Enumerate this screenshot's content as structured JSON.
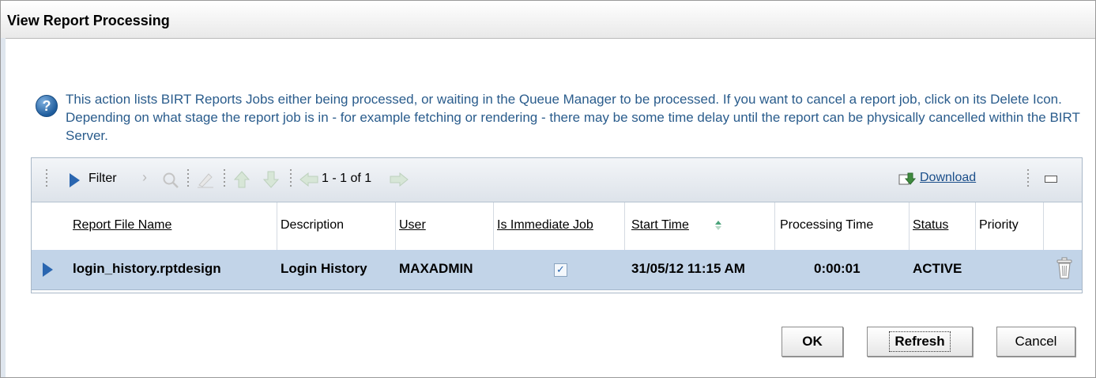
{
  "dialog": {
    "title": "View Report Processing"
  },
  "info": {
    "text": "This action lists BIRT Reports Jobs either being processed, or waiting in the Queue Manager to be processed. If you want to cancel a report job, click on its Delete Icon. Depending on what stage the report job is in - for example fetching or rendering - there may be some time delay until the report can be physically cancelled within the BIRT Server."
  },
  "toolbar": {
    "filter_label": "Filter",
    "pagination": "1 - 1 of 1",
    "download_label": "Download"
  },
  "table": {
    "headers": [
      "Report File Name",
      "Description",
      "User",
      "Is Immediate Job",
      "Start Time",
      "Processing Time",
      "Status",
      "Priority"
    ],
    "rows": [
      {
        "file_name": "login_history.rptdesign",
        "description": "Login History",
        "user": "MAXADMIN",
        "is_immediate": true,
        "start_time": "31/05/12 11:15 AM",
        "processing_time": "0:00:01",
        "status": "ACTIVE",
        "priority": ""
      }
    ]
  },
  "buttons": {
    "ok": "OK",
    "refresh": "Refresh",
    "cancel": "Cancel"
  }
}
